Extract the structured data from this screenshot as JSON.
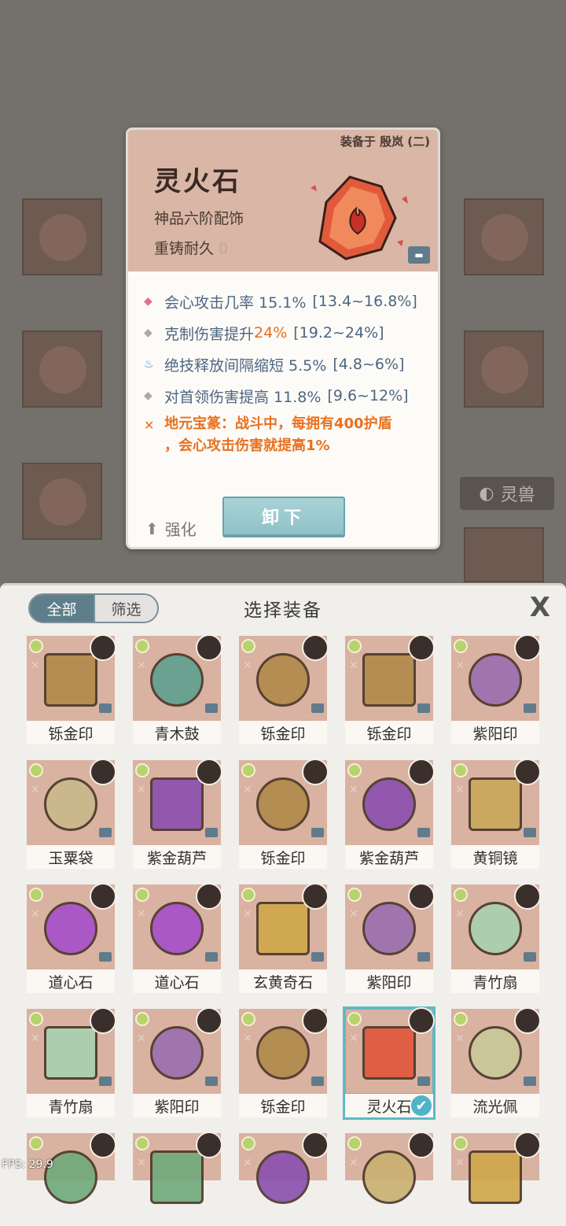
{
  "card": {
    "equipped_to": "装备于 殷岚 (二)",
    "name": "灵火石",
    "grade": "神品六阶配饰",
    "durability_label": "重铸耐久",
    "durability_value": "0",
    "stats": [
      {
        "icon": "pink-diamond-icon",
        "text": "会心攻击几率 15.1%",
        "range": "[13.4~16.8%]"
      },
      {
        "icon": "grey-diamond-icon",
        "text_pre": "克制伤害提升",
        "text_hl": "24%",
        "range": "[19.2~24%]"
      },
      {
        "icon": "blue-flame-icon",
        "text": "绝技释放间隔缩短 5.5%",
        "range": "[4.8~6%]"
      },
      {
        "icon": "grey-diamond-icon",
        "text": "对首领伤害提高 11.8%",
        "range": "[9.6~12%]"
      }
    ],
    "skill_line1": "地元宝篆：战斗中，每拥有400护盾",
    "skill_line2": "，会心攻击伤害就提高1%",
    "enhance_label": "强化",
    "unequip_label": "卸下"
  },
  "background": {
    "tab_label": "灵兽"
  },
  "panel": {
    "tab_all": "全部",
    "tab_filter": "筛选",
    "title": "选择装备",
    "close": "X"
  },
  "items": [
    {
      "name": "铄金印",
      "color": "#b08a4a"
    },
    {
      "name": "青木鼓",
      "color": "#5fa090"
    },
    {
      "name": "铄金印",
      "color": "#b08a4a"
    },
    {
      "name": "铄金印",
      "color": "#b08a4a"
    },
    {
      "name": "紫阳印",
      "color": "#9a6fb0"
    },
    {
      "name": "玉粟袋",
      "color": "#c9b98a"
    },
    {
      "name": "紫金葫芦",
      "color": "#8a4fb0"
    },
    {
      "name": "铄金印",
      "color": "#b08a4a"
    },
    {
      "name": "紫金葫芦",
      "color": "#8a4fb0"
    },
    {
      "name": "黄铜镜",
      "color": "#c9a85a"
    },
    {
      "name": "道心石",
      "color": "#a64fc9"
    },
    {
      "name": "道心石",
      "color": "#a64fc9"
    },
    {
      "name": "玄黄奇石",
      "color": "#d0a84a"
    },
    {
      "name": "紫阳印",
      "color": "#9a6fb0"
    },
    {
      "name": "青竹扇",
      "color": "#a8d0b0"
    },
    {
      "name": "青竹扇",
      "color": "#a8d0b0"
    },
    {
      "name": "紫阳印",
      "color": "#9a6fb0"
    },
    {
      "name": "铄金印",
      "color": "#b08a4a"
    },
    {
      "name": "灵火石",
      "color": "#e0553a",
      "selected": true
    },
    {
      "name": "流光佩",
      "color": "#c9c99a"
    },
    {
      "name": "",
      "color": "#6faa7a"
    },
    {
      "name": "",
      "color": "#6faa7a"
    },
    {
      "name": "",
      "color": "#8a4fb0"
    },
    {
      "name": "",
      "color": "#c9b070"
    },
    {
      "name": "",
      "color": "#d0a84a"
    }
  ],
  "fps": "FPS: 29.9"
}
